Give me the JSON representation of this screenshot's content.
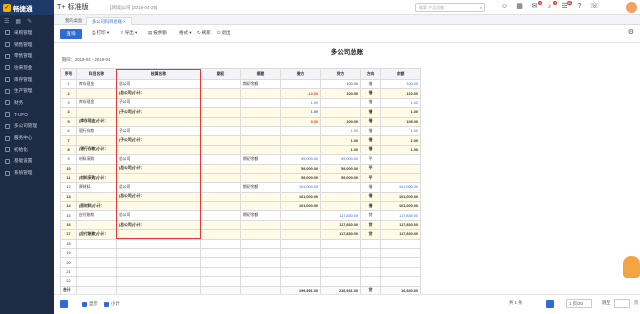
{
  "app": {
    "logo_text": "畅捷通",
    "brand": "T+",
    "edition": "标准版",
    "company": "[测试]公司 [2019-04-29]",
    "search_placeholder": "搜索·产品功能",
    "badges": [
      "6",
      "2",
      "99"
    ]
  },
  "sidebar": {
    "items": [
      {
        "label": "采购管理"
      },
      {
        "label": "销售管理"
      },
      {
        "label": "零售管理"
      },
      {
        "label": "往来现金"
      },
      {
        "label": "库存管理"
      },
      {
        "label": "生产管理"
      },
      {
        "label": "财务"
      },
      {
        "label": "T-UFO"
      },
      {
        "label": "多公司管理"
      },
      {
        "label": "服务中心"
      },
      {
        "label": "初始化"
      },
      {
        "label": "基础设置"
      },
      {
        "label": "系统管理"
      }
    ]
  },
  "tabs": [
    {
      "label": "我的桌面"
    },
    {
      "label": "多公司科目总账 ×"
    }
  ],
  "toolbar": {
    "query": "查询",
    "print": "打印",
    "export": "导出",
    "balance": "按余额",
    "format": "格式",
    "refresh": "刷新",
    "exit": "退出"
  },
  "report": {
    "title": "多公司总账",
    "period": "期间：2019-04 - 2019-04",
    "columns": [
      "序号",
      "科目名称",
      "核算名称",
      "期初",
      "摘要",
      "借方",
      "贷方",
      "方向",
      "余额"
    ],
    "rows": [
      {
        "no": "1",
        "subject": "库存现金",
        "company": "总公司",
        "init": "",
        "summary": "期初余额",
        "debit": "",
        "credit": "100.00",
        "dir": "借",
        "balance": "100.00",
        "type": "normal",
        "debit_color": "blue",
        "balance_color": "blue"
      },
      {
        "no": "2",
        "subject": "",
        "company": "(总公司)小计：",
        "init": "",
        "summary": "",
        "debit": "-10.00",
        "credit": "100.00",
        "dir": "借",
        "balance": "110.00",
        "type": "sub",
        "debit_color": "neg"
      },
      {
        "no": "3",
        "subject": "库存现金",
        "company": "子公司",
        "init": "",
        "summary": "",
        "debit": "1.00",
        "credit": "",
        "dir": "借",
        "balance": "1.00",
        "type": "normal",
        "debit_color": "blue",
        "balance_color": "blue"
      },
      {
        "no": "4",
        "subject": "",
        "company": "(子公司)小计：",
        "init": "",
        "summary": "",
        "debit": "1.00",
        "credit": "",
        "dir": "借",
        "balance": "1.00",
        "type": "sub",
        "debit_color": "blue"
      },
      {
        "no": "5",
        "subject": "(库存现金)小计：",
        "company": "",
        "init": "",
        "summary": "",
        "debit": "9.00",
        "credit": "100.00",
        "dir": "借",
        "balance": "105.00",
        "type": "sub",
        "debit_color": "neg"
      },
      {
        "no": "6",
        "subject": "银行存款",
        "company": "子公司",
        "init": "",
        "summary": "",
        "debit": "",
        "credit": "1.00",
        "dir": "借",
        "balance": "1.00",
        "type": "normal",
        "credit_color": "blue",
        "balance_color": "blue"
      },
      {
        "no": "7",
        "subject": "",
        "company": "(子公司)小计：",
        "init": "",
        "summary": "",
        "debit": "",
        "credit": "1.00",
        "dir": "借",
        "balance": "1.00",
        "type": "sub"
      },
      {
        "no": "8",
        "subject": "(银行存款)小计：",
        "company": "",
        "init": "",
        "summary": "",
        "debit": "",
        "credit": "1.00",
        "dir": "借",
        "balance": "1.00",
        "type": "sub"
      },
      {
        "no": "9",
        "subject": "材料采购",
        "company": "总公司",
        "init": "",
        "summary": "期初余额",
        "debit": "59,000.00",
        "credit": "59,000.00",
        "dir": "平",
        "balance": "",
        "type": "normal",
        "debit_color": "blue",
        "credit_color": "blue"
      },
      {
        "no": "10",
        "subject": "",
        "company": "(总公司)小计：",
        "init": "",
        "summary": "",
        "debit": "59,000.00",
        "credit": "59,000.00",
        "dir": "平",
        "balance": "",
        "type": "sub"
      },
      {
        "no": "11",
        "subject": "(材料采购)小计：",
        "company": "",
        "init": "",
        "summary": "",
        "debit": "59,000.00",
        "credit": "59,000.00",
        "dir": "平",
        "balance": "",
        "type": "sub"
      },
      {
        "no": "12",
        "subject": "原材料",
        "company": "总公司",
        "init": "",
        "summary": "期初余额",
        "debit": "101,000.00",
        "credit": "",
        "dir": "借",
        "balance": "101,000.00",
        "type": "normal",
        "debit_color": "blue",
        "balance_color": "blue"
      },
      {
        "no": "13",
        "subject": "",
        "company": "(总公司)小计：",
        "init": "",
        "summary": "",
        "debit": "101,000.00",
        "credit": "",
        "dir": "借",
        "balance": "101,000.00",
        "type": "sub"
      },
      {
        "no": "14",
        "subject": "(原材料)小计：",
        "company": "",
        "init": "",
        "summary": "",
        "debit": "101,000.00",
        "credit": "",
        "dir": "借",
        "balance": "101,000.00",
        "type": "sub"
      },
      {
        "no": "15",
        "subject": "应付账款",
        "company": "总公司",
        "init": "",
        "summary": "期初余额",
        "debit": "",
        "credit": "117,830.00",
        "dir": "贷",
        "balance": "117,830.00",
        "type": "normal",
        "credit_color": "blue",
        "balance_color": "blue"
      },
      {
        "no": "16",
        "subject": "",
        "company": "(总公司)小计：",
        "init": "",
        "summary": "",
        "debit": "",
        "credit": "117,830.00",
        "dir": "贷",
        "balance": "117,830.00",
        "type": "sub"
      },
      {
        "no": "17",
        "subject": "(应付账款)小计：",
        "company": "",
        "init": "",
        "summary": "",
        "debit": "",
        "credit": "117,830.00",
        "dir": "贷",
        "balance": "117,830.00",
        "type": "sub"
      },
      {
        "no": "18",
        "subject": "",
        "company": "",
        "init": "",
        "summary": "",
        "debit": "",
        "credit": "",
        "dir": "",
        "balance": "",
        "type": "empty"
      },
      {
        "no": "19",
        "subject": "",
        "company": "",
        "init": "",
        "summary": "",
        "debit": "",
        "credit": "",
        "dir": "",
        "balance": "",
        "type": "empty"
      },
      {
        "no": "20",
        "subject": "",
        "company": "",
        "init": "",
        "summary": "",
        "debit": "",
        "credit": "",
        "dir": "",
        "balance": "",
        "type": "empty"
      },
      {
        "no": "21",
        "subject": "",
        "company": "",
        "init": "",
        "summary": "",
        "debit": "",
        "credit": "",
        "dir": "",
        "balance": "",
        "type": "empty"
      },
      {
        "no": "22",
        "subject": "",
        "company": "",
        "init": "",
        "summary": "",
        "debit": "",
        "credit": "",
        "dir": "",
        "balance": "",
        "type": "empty"
      }
    ],
    "total": {
      "label": "合计",
      "debit": "199,991.00",
      "credit": "216,931.00",
      "dir": "贷",
      "balance": "16,940.00"
    }
  },
  "footer": {
    "check1": "显示",
    "check2": "小计",
    "page_info": "共 1 条",
    "page_size": "1 页/20",
    "goto": "跳至",
    "page_suffix": "页"
  },
  "colors": {
    "accent": "#2f6bd6",
    "sidebar": "#1d2b44",
    "highlight": "#e53935"
  }
}
